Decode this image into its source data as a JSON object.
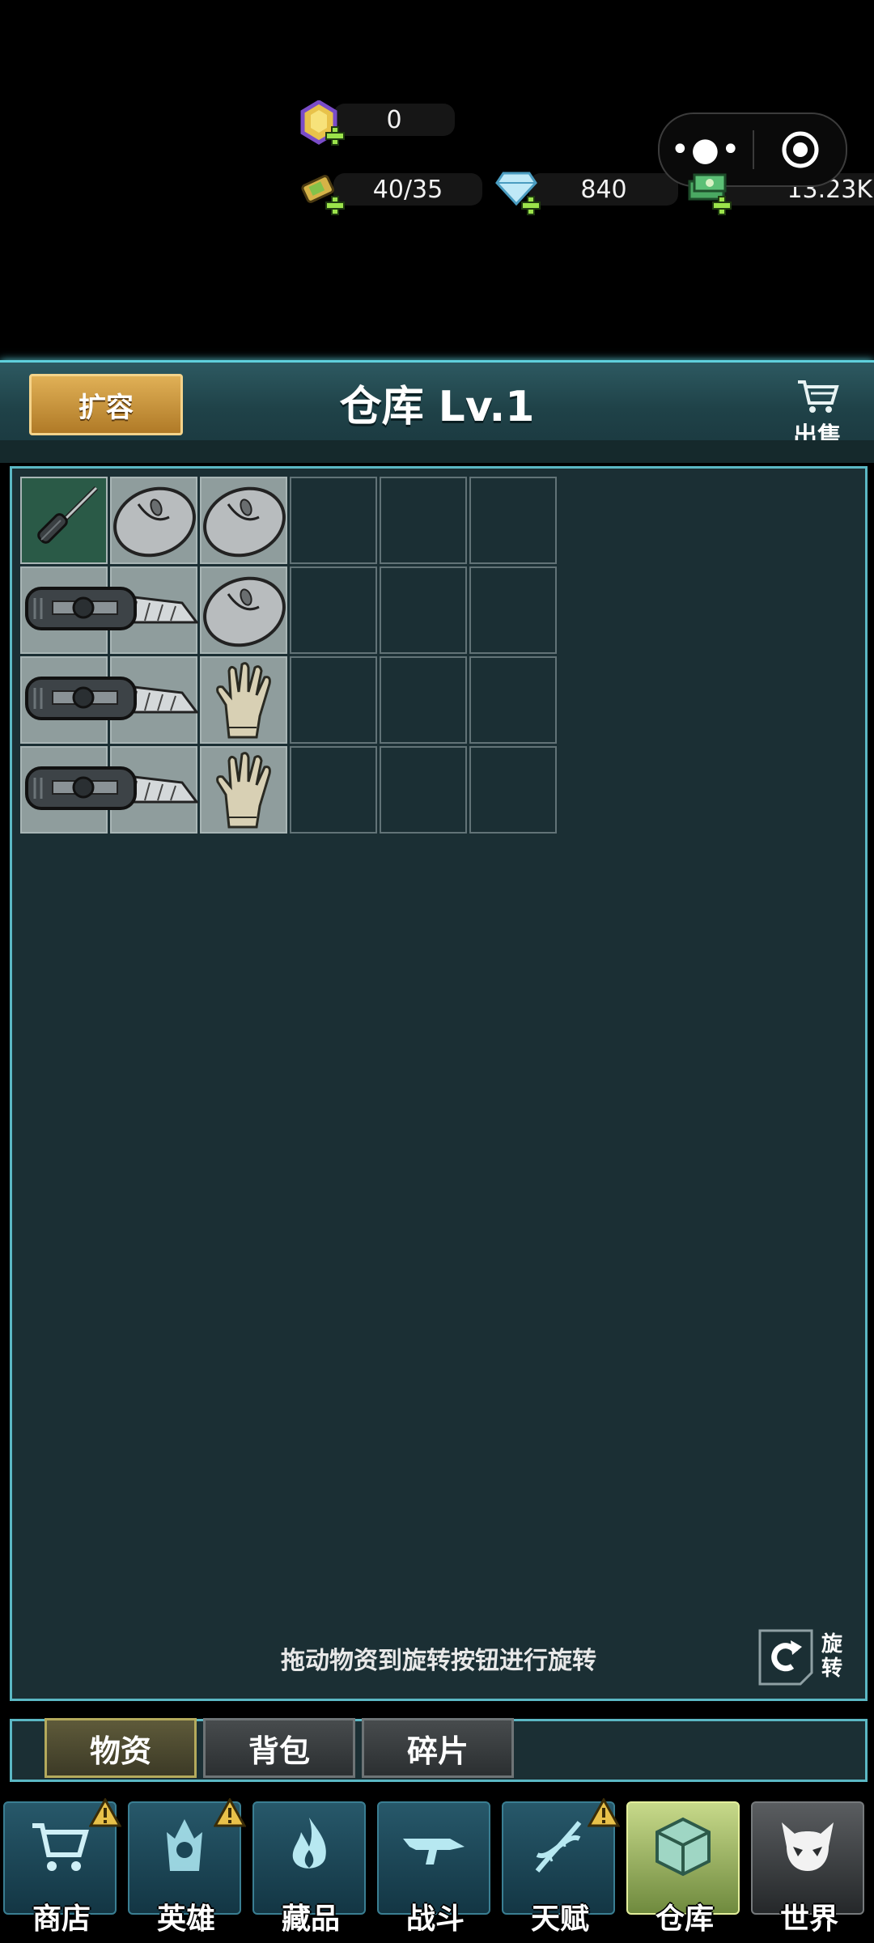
{
  "resources": {
    "tickets": "0",
    "energy": "40/35",
    "diamonds": "840",
    "cash": "13.23K"
  },
  "header": {
    "expand_label": "扩容",
    "title": "仓库 Lv.1",
    "sell_label": "出售"
  },
  "panel": {
    "hint": "拖动物资到旋转按钮进行旋转",
    "rotate_label": "旋转"
  },
  "tabs": [
    {
      "label": "物资",
      "active": true
    },
    {
      "label": "背包",
      "active": false
    },
    {
      "label": "碎片",
      "active": false
    }
  ],
  "nav": [
    {
      "label": "商店",
      "icon": "cart-icon",
      "alert": true
    },
    {
      "label": "英雄",
      "icon": "hero-icon",
      "alert": true
    },
    {
      "label": "藏品",
      "icon": "flame-icon",
      "alert": false
    },
    {
      "label": "战斗",
      "icon": "rifle-icon",
      "alert": false
    },
    {
      "label": "天赋",
      "icon": "dna-icon",
      "alert": true
    },
    {
      "label": "仓库",
      "icon": "crate-icon",
      "alert": false,
      "active": true
    },
    {
      "label": "世界",
      "icon": "skull-icon",
      "alert": false
    }
  ],
  "inventory": {
    "items": [
      "screwdriver",
      "mouse",
      "mouse",
      "utility-knife",
      "mouse",
      "utility-knife",
      "glove",
      "utility-knife",
      "glove"
    ]
  }
}
